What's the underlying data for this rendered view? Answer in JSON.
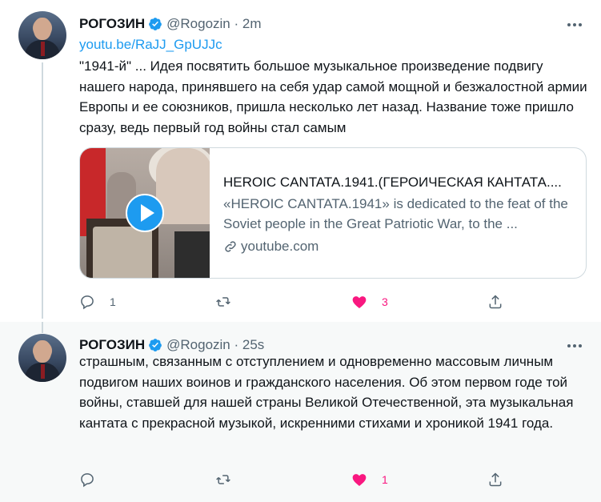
{
  "tweets": [
    {
      "author": {
        "name": "РОГОЗИН",
        "handle": "@Rogozin · 2m"
      },
      "link": "youtu.be/RaJJ_GpUJJc",
      "text": "\"1941-й\" ... Идея посвятить большое музыкальное произведение подвигу нашего народа, принявшего на себя удар самой мощной и безжалостной армии Европы и ее союзников, пришла несколько лет назад. Название тоже пришло сразу, ведь первый год войны стал самым",
      "card": {
        "title": "HEROIC CANTATA.1941.(ГЕРОИЧЕСКАЯ КАНТАТА....",
        "description": "«HEROIC CANTATA.1941» is dedicated to the feat of the Soviet people in the Great Patriotic War, to the ...",
        "domain": "youtube.com"
      },
      "actions": {
        "replies": "1",
        "retweets": "",
        "likes": "3"
      }
    },
    {
      "author": {
        "name": "РОГОЗИН",
        "handle": "@Rogozin · 25s"
      },
      "text": "страшным, связанным с отступлением и одновременно массовым личным подвигом наших воинов и гражданского населения. Об этом первом годе той войны, ставшей для нашей страны Великой Отечественной, эта музыкальная кантата с прекрасной музыкой, искренними стихами и хроникой 1941 года.",
      "actions": {
        "replies": "",
        "retweets": "",
        "likes": "1"
      }
    }
  ],
  "colors": {
    "accent": "#1d9bf0",
    "like": "#f91880",
    "muted": "#536471"
  },
  "icons": [
    "verified-icon",
    "more-icon",
    "play-icon",
    "link-icon",
    "reply-icon",
    "retweet-icon",
    "like-icon",
    "share-icon"
  ]
}
